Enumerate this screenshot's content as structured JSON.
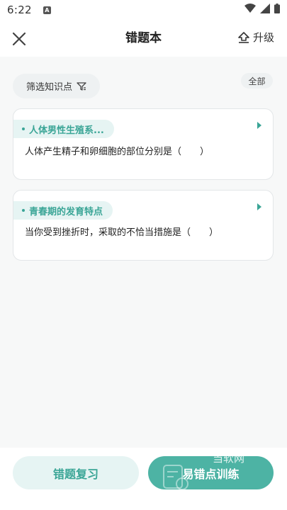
{
  "status_bar": {
    "time": "6:22",
    "notification_badge": "A",
    "icons": [
      "wifi-icon",
      "signal-icon",
      "battery-icon"
    ]
  },
  "header": {
    "title": "错题本",
    "upgrade_label": "升级",
    "icons": [
      "close-icon",
      "upload-arrow-icon"
    ]
  },
  "filters": {
    "knowledge_filter_label": "筛选知识点",
    "all_label": "全部"
  },
  "cards": [
    {
      "tag": "人体男性生殖系...",
      "question": "人体产生精子和卵细胞的部位分别是（　　）"
    },
    {
      "tag": "青春期的发育特点",
      "question": "当你受到挫折时，采取的不恰当措施是（　　）"
    }
  ],
  "bottom": {
    "review_label": "错题复习",
    "train_label": "易错点训练",
    "watermark": "当软网"
  },
  "colors": {
    "accent": "#4db3a4",
    "accent_light": "#e6f4f3",
    "tag_text": "#3aa596"
  }
}
